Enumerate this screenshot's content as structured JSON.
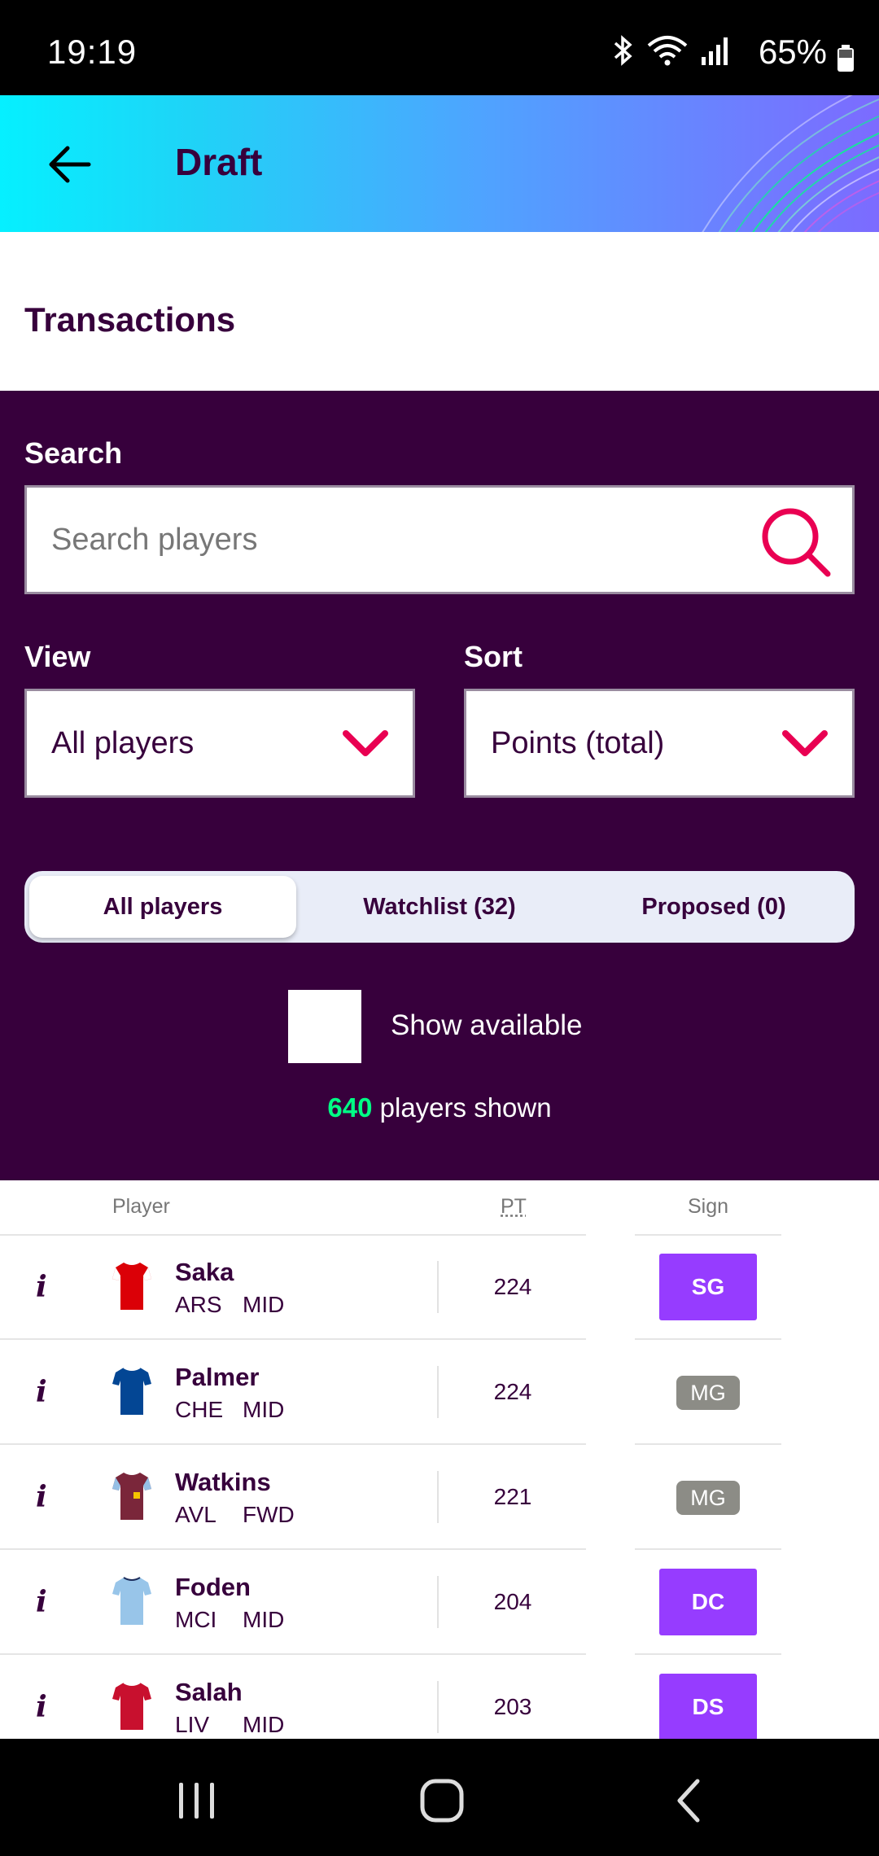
{
  "status_bar": {
    "time": "19:19",
    "battery": "65%"
  },
  "header": {
    "title": "Draft"
  },
  "page": {
    "title": "Transactions"
  },
  "filters": {
    "search_label": "Search",
    "search_placeholder": "Search players",
    "view_label": "View",
    "view_value": "All players",
    "sort_label": "Sort",
    "sort_value": "Points (total)",
    "tabs": [
      {
        "label": "All players",
        "active": true
      },
      {
        "label": "Watchlist (32)",
        "active": false
      },
      {
        "label": "Proposed (0)",
        "active": false
      }
    ],
    "show_available_label": "Show available",
    "players_count": "640",
    "players_shown_text": "players shown"
  },
  "table": {
    "columns": {
      "player": "Player",
      "points": "PT",
      "sign": "Sign"
    },
    "rows": [
      {
        "name": "Saka",
        "team": "ARS",
        "position": "MID",
        "points": "224",
        "sign": "SG",
        "sign_style": "button",
        "shirt_color": "#db0007"
      },
      {
        "name": "Palmer",
        "team": "CHE",
        "position": "MID",
        "points": "224",
        "sign": "MG",
        "sign_style": "badge",
        "shirt_color": "#034694"
      },
      {
        "name": "Watkins",
        "team": "AVL",
        "position": "FWD",
        "points": "221",
        "sign": "MG",
        "sign_style": "badge",
        "shirt_color": "#7a263a"
      },
      {
        "name": "Foden",
        "team": "MCI",
        "position": "MID",
        "points": "204",
        "sign": "DC",
        "sign_style": "button",
        "shirt_color": "#98c5e9"
      },
      {
        "name": "Salah",
        "team": "LIV",
        "position": "MID",
        "points": "203",
        "sign": "DS",
        "sign_style": "button",
        "shirt_color": "#c8102e"
      }
    ]
  },
  "colors": {
    "primary": "#37003c",
    "accent_pink": "#e90052",
    "accent_green": "#00ff85",
    "sign_purple": "#963cff"
  }
}
